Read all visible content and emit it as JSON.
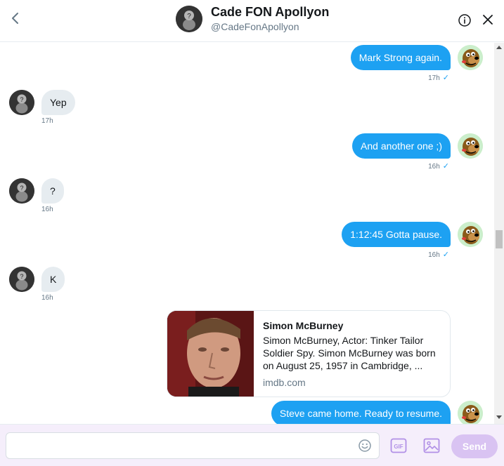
{
  "header": {
    "name": "Cade FON Apollyon",
    "handle": "@CadeFonApollyon",
    "back_icon": "chevron-left-icon",
    "info_icon": "info-icon",
    "close_icon": "close-icon"
  },
  "messages": [
    {
      "side": "sent",
      "text": "Mark Strong again.",
      "time": "17h"
    },
    {
      "side": "recv",
      "text": "Yep",
      "time": "17h"
    },
    {
      "side": "sent",
      "text": "And another one ;)",
      "time": "16h"
    },
    {
      "side": "recv",
      "text": "?",
      "time": "16h"
    },
    {
      "side": "sent",
      "text": "1:12:45 Gotta pause.",
      "time": "16h"
    },
    {
      "side": "recv",
      "text": "K",
      "time": "16h"
    },
    {
      "side": "sent",
      "text": "Steve came home. Ready to resume.",
      "time": ""
    }
  ],
  "link_card": {
    "title": "Simon McBurney",
    "description": "Simon McBurney, Actor: Tinker Tailor Soldier Spy. Simon McBurney was born on August 25, 1957 in Cambridge, ...",
    "domain": "imdb.com"
  },
  "composer": {
    "placeholder": "",
    "value": "",
    "gif_label": "GIF",
    "send_label": "Send"
  },
  "colors": {
    "accent": "#1da1f2",
    "send_disabled": "#d9c3f2",
    "composer_bg": "#f5eefb"
  }
}
